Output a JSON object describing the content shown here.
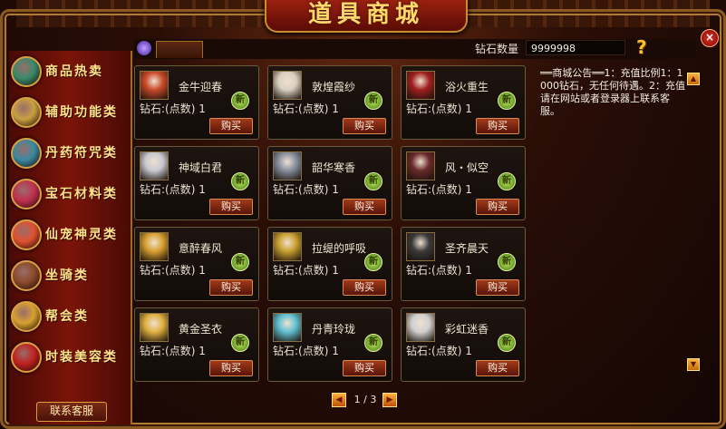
{
  "title": "道具商城",
  "sidebar": {
    "items": [
      {
        "label": "商品热卖",
        "icon": "treasure-chest-icon",
        "color": "#3a8a6a"
      },
      {
        "label": "辅助功能类",
        "icon": "scroll-icon",
        "color": "#c8a040"
      },
      {
        "label": "丹药符咒类",
        "icon": "orb-icon",
        "color": "#3a8aa0"
      },
      {
        "label": "宝石材料类",
        "icon": "gem-icon",
        "color": "#c03050"
      },
      {
        "label": "仙宠神灵类",
        "icon": "spirit-pet-icon",
        "color": "#e05030"
      },
      {
        "label": "坐骑类",
        "icon": "mount-icon",
        "color": "#8a4a2a"
      },
      {
        "label": "帮会类",
        "icon": "guild-icon",
        "color": "#d8a030"
      },
      {
        "label": "时装美容类",
        "icon": "fashion-icon",
        "color": "#c02020"
      }
    ],
    "contact_label": "联系客服"
  },
  "header": {
    "diamond_label": "钻石数量",
    "diamond_value": "9999998"
  },
  "products": [
    {
      "name": "金牛迎春",
      "price": "钻石:(点数) 1",
      "buy": "购买",
      "badge": "新",
      "color": "#c84a2a"
    },
    {
      "name": "敦煌霞纱",
      "price": "钻石:(点数) 1",
      "buy": "购买",
      "badge": "新",
      "color": "#d8d0c0"
    },
    {
      "name": "浴火重生",
      "price": "钻石:(点数) 1",
      "buy": "购买",
      "badge": "新",
      "color": "#a02020"
    },
    {
      "name": "神域白君",
      "price": "钻石:(点数) 1",
      "buy": "购买",
      "badge": "新",
      "color": "#c8c8d0"
    },
    {
      "name": "韶华寒香",
      "price": "钻石:(点数) 1",
      "buy": "购买",
      "badge": "新",
      "color": "#8890a0"
    },
    {
      "name": "风・似空",
      "price": "钻石:(点数) 1",
      "buy": "购买",
      "badge": "新",
      "color": "#6a2a2a"
    },
    {
      "name": "意醉春风",
      "price": "钻石:(点数) 1",
      "buy": "购买",
      "badge": "新",
      "color": "#d8a030"
    },
    {
      "name": "拉缇的呼吸",
      "price": "钻石:(点数) 1",
      "buy": "购买",
      "badge": "新",
      "color": "#c8a030"
    },
    {
      "name": "圣齐晨天",
      "price": "钻石:(点数) 1",
      "buy": "购买",
      "badge": "新",
      "color": "#3a3a3a"
    },
    {
      "name": "黄金圣衣",
      "price": "钻石:(点数) 1",
      "buy": "购买",
      "badge": "新",
      "color": "#e0b040"
    },
    {
      "name": "丹青玲珑",
      "price": "钻石:(点数) 1",
      "buy": "购买",
      "badge": "新",
      "color": "#60c0d0"
    },
    {
      "name": "彩虹迷香",
      "price": "钻石:(点数) 1",
      "buy": "购买",
      "badge": "新",
      "color": "#d0d0d0"
    }
  ],
  "announcement": "══商城公告══1：充值比例1：1000钻石，无任何待遇。2：充值请在网站或者登录器上联系客服。",
  "pagination": {
    "text": "1 / 3",
    "prev": "◀",
    "next": "▶"
  },
  "close_label": "×",
  "help_label": "?"
}
